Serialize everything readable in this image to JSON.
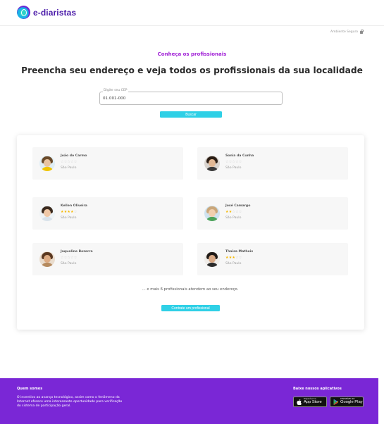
{
  "header": {
    "logo_text": "e-diaristas",
    "secure_label": "Ambiente Seguro"
  },
  "hero": {
    "subtitle": "Conheça os profissionais",
    "title": "Preencha seu endereço e veja todos os profissionais da sua localidade"
  },
  "search": {
    "label": "Digite seu CEP",
    "value": "01.001-000",
    "button_label": "Buscar"
  },
  "professionals": [
    {
      "name": "João do Carmo",
      "rating": 0,
      "city": "São Paulo"
    },
    {
      "name": "Sonia da Cunha",
      "rating": 0,
      "city": "São Paulo"
    },
    {
      "name": "Kellen Oliveira",
      "rating": 4,
      "city": "São Paulo"
    },
    {
      "name": "José Camargo",
      "rating": 2,
      "city": "São Paulo"
    },
    {
      "name": "Jaqueline Bezerra",
      "rating": 0,
      "city": "São Paulo"
    },
    {
      "name": "Thaisa Matheis",
      "rating": 3,
      "city": "São Paulo"
    }
  ],
  "results": {
    "more_text": "... e mais 6 profissionais atendem ao seu endereço.",
    "contact_button": "Contrate um profissional"
  },
  "footer": {
    "about_title": "Quem somos",
    "about_text": "O incentivo ao avanço tecnológico, assim como o fenômeno da Internet oferece uma interessante oportunidade para verificação do sistema de participação geral.",
    "apps_title": "Baixe nossos aplicativos",
    "appstore_small": "Disponível na",
    "appstore_big": "App Store",
    "googleplay_small": "DISPONÍVEL NO",
    "googleplay_big": "Google Play"
  },
  "colors": {
    "brand_purple": "#7a27d6",
    "accent_cyan": "#2fd0e6",
    "star_gold": "#f5b800"
  },
  "icons": {
    "logo": "logo-icon",
    "secure": "lock-icon",
    "appstore": "apple-icon",
    "googleplay": "play-icon"
  }
}
